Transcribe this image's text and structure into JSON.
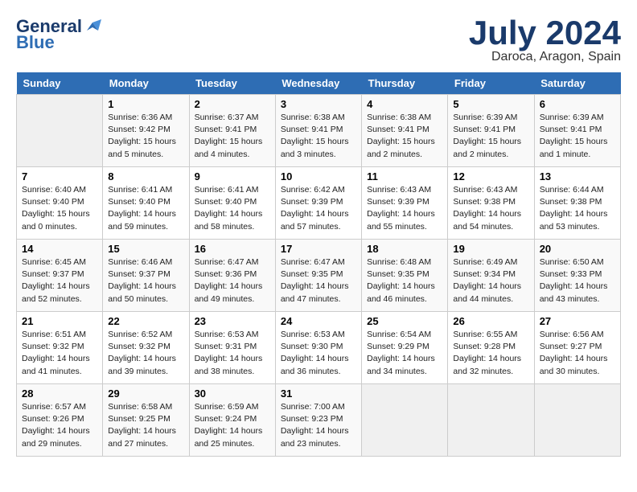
{
  "logo": {
    "text_general": "General",
    "text_blue": "Blue",
    "icon": "▶"
  },
  "title": "July 2024",
  "location": "Daroca, Aragon, Spain",
  "days_of_week": [
    "Sunday",
    "Monday",
    "Tuesday",
    "Wednesday",
    "Thursday",
    "Friday",
    "Saturday"
  ],
  "weeks": [
    [
      {
        "day": "",
        "sunrise": "",
        "sunset": "",
        "daylight": ""
      },
      {
        "day": "1",
        "sunrise": "Sunrise: 6:36 AM",
        "sunset": "Sunset: 9:42 PM",
        "daylight": "Daylight: 15 hours and 5 minutes."
      },
      {
        "day": "2",
        "sunrise": "Sunrise: 6:37 AM",
        "sunset": "Sunset: 9:41 PM",
        "daylight": "Daylight: 15 hours and 4 minutes."
      },
      {
        "day": "3",
        "sunrise": "Sunrise: 6:38 AM",
        "sunset": "Sunset: 9:41 PM",
        "daylight": "Daylight: 15 hours and 3 minutes."
      },
      {
        "day": "4",
        "sunrise": "Sunrise: 6:38 AM",
        "sunset": "Sunset: 9:41 PM",
        "daylight": "Daylight: 15 hours and 2 minutes."
      },
      {
        "day": "5",
        "sunrise": "Sunrise: 6:39 AM",
        "sunset": "Sunset: 9:41 PM",
        "daylight": "Daylight: 15 hours and 2 minutes."
      },
      {
        "day": "6",
        "sunrise": "Sunrise: 6:39 AM",
        "sunset": "Sunset: 9:41 PM",
        "daylight": "Daylight: 15 hours and 1 minute."
      }
    ],
    [
      {
        "day": "7",
        "sunrise": "Sunrise: 6:40 AM",
        "sunset": "Sunset: 9:40 PM",
        "daylight": "Daylight: 15 hours and 0 minutes."
      },
      {
        "day": "8",
        "sunrise": "Sunrise: 6:41 AM",
        "sunset": "Sunset: 9:40 PM",
        "daylight": "Daylight: 14 hours and 59 minutes."
      },
      {
        "day": "9",
        "sunrise": "Sunrise: 6:41 AM",
        "sunset": "Sunset: 9:40 PM",
        "daylight": "Daylight: 14 hours and 58 minutes."
      },
      {
        "day": "10",
        "sunrise": "Sunrise: 6:42 AM",
        "sunset": "Sunset: 9:39 PM",
        "daylight": "Daylight: 14 hours and 57 minutes."
      },
      {
        "day": "11",
        "sunrise": "Sunrise: 6:43 AM",
        "sunset": "Sunset: 9:39 PM",
        "daylight": "Daylight: 14 hours and 55 minutes."
      },
      {
        "day": "12",
        "sunrise": "Sunrise: 6:43 AM",
        "sunset": "Sunset: 9:38 PM",
        "daylight": "Daylight: 14 hours and 54 minutes."
      },
      {
        "day": "13",
        "sunrise": "Sunrise: 6:44 AM",
        "sunset": "Sunset: 9:38 PM",
        "daylight": "Daylight: 14 hours and 53 minutes."
      }
    ],
    [
      {
        "day": "14",
        "sunrise": "Sunrise: 6:45 AM",
        "sunset": "Sunset: 9:37 PM",
        "daylight": "Daylight: 14 hours and 52 minutes."
      },
      {
        "day": "15",
        "sunrise": "Sunrise: 6:46 AM",
        "sunset": "Sunset: 9:37 PM",
        "daylight": "Daylight: 14 hours and 50 minutes."
      },
      {
        "day": "16",
        "sunrise": "Sunrise: 6:47 AM",
        "sunset": "Sunset: 9:36 PM",
        "daylight": "Daylight: 14 hours and 49 minutes."
      },
      {
        "day": "17",
        "sunrise": "Sunrise: 6:47 AM",
        "sunset": "Sunset: 9:35 PM",
        "daylight": "Daylight: 14 hours and 47 minutes."
      },
      {
        "day": "18",
        "sunrise": "Sunrise: 6:48 AM",
        "sunset": "Sunset: 9:35 PM",
        "daylight": "Daylight: 14 hours and 46 minutes."
      },
      {
        "day": "19",
        "sunrise": "Sunrise: 6:49 AM",
        "sunset": "Sunset: 9:34 PM",
        "daylight": "Daylight: 14 hours and 44 minutes."
      },
      {
        "day": "20",
        "sunrise": "Sunrise: 6:50 AM",
        "sunset": "Sunset: 9:33 PM",
        "daylight": "Daylight: 14 hours and 43 minutes."
      }
    ],
    [
      {
        "day": "21",
        "sunrise": "Sunrise: 6:51 AM",
        "sunset": "Sunset: 9:32 PM",
        "daylight": "Daylight: 14 hours and 41 minutes."
      },
      {
        "day": "22",
        "sunrise": "Sunrise: 6:52 AM",
        "sunset": "Sunset: 9:32 PM",
        "daylight": "Daylight: 14 hours and 39 minutes."
      },
      {
        "day": "23",
        "sunrise": "Sunrise: 6:53 AM",
        "sunset": "Sunset: 9:31 PM",
        "daylight": "Daylight: 14 hours and 38 minutes."
      },
      {
        "day": "24",
        "sunrise": "Sunrise: 6:53 AM",
        "sunset": "Sunset: 9:30 PM",
        "daylight": "Daylight: 14 hours and 36 minutes."
      },
      {
        "day": "25",
        "sunrise": "Sunrise: 6:54 AM",
        "sunset": "Sunset: 9:29 PM",
        "daylight": "Daylight: 14 hours and 34 minutes."
      },
      {
        "day": "26",
        "sunrise": "Sunrise: 6:55 AM",
        "sunset": "Sunset: 9:28 PM",
        "daylight": "Daylight: 14 hours and 32 minutes."
      },
      {
        "day": "27",
        "sunrise": "Sunrise: 6:56 AM",
        "sunset": "Sunset: 9:27 PM",
        "daylight": "Daylight: 14 hours and 30 minutes."
      }
    ],
    [
      {
        "day": "28",
        "sunrise": "Sunrise: 6:57 AM",
        "sunset": "Sunset: 9:26 PM",
        "daylight": "Daylight: 14 hours and 29 minutes."
      },
      {
        "day": "29",
        "sunrise": "Sunrise: 6:58 AM",
        "sunset": "Sunset: 9:25 PM",
        "daylight": "Daylight: 14 hours and 27 minutes."
      },
      {
        "day": "30",
        "sunrise": "Sunrise: 6:59 AM",
        "sunset": "Sunset: 9:24 PM",
        "daylight": "Daylight: 14 hours and 25 minutes."
      },
      {
        "day": "31",
        "sunrise": "Sunrise: 7:00 AM",
        "sunset": "Sunset: 9:23 PM",
        "daylight": "Daylight: 14 hours and 23 minutes."
      },
      {
        "day": "",
        "sunrise": "",
        "sunset": "",
        "daylight": ""
      },
      {
        "day": "",
        "sunrise": "",
        "sunset": "",
        "daylight": ""
      },
      {
        "day": "",
        "sunrise": "",
        "sunset": "",
        "daylight": ""
      }
    ]
  ]
}
